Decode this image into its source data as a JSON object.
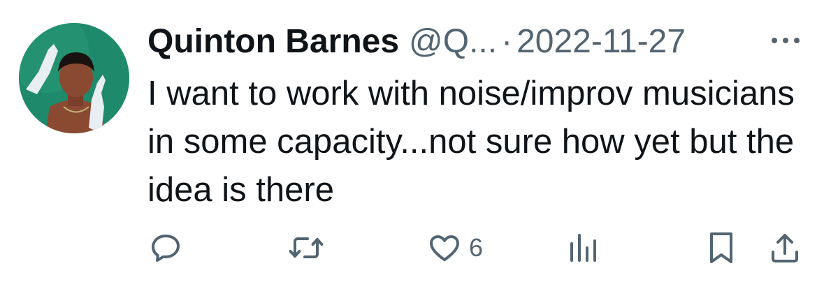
{
  "tweet": {
    "author_name": "Quinton Barnes",
    "handle": "@Q...",
    "separator": "·",
    "timestamp": "2022-11-27",
    "text": "I want to work with noise/improv musicians in some capacity...not sure how yet but the idea is there",
    "avatar_icon": "profile-photo",
    "avatar_bg_color": "#1f8a6b"
  },
  "actions": {
    "reply_icon": "reply-icon",
    "retweet_icon": "retweet-icon",
    "like_icon": "heart-icon",
    "like_count": "6",
    "views_icon": "views-bar-chart-icon",
    "bookmark_icon": "bookmark-icon",
    "share_icon": "share-icon",
    "more_icon": "more-dots-icon",
    "icon_color": "#536471"
  }
}
